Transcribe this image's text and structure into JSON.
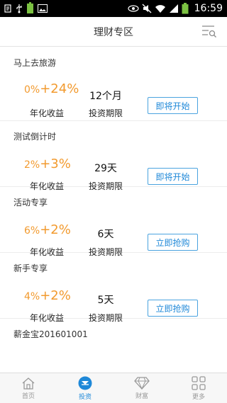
{
  "status_bar": {
    "time": "16:59",
    "icons": [
      "notification-icon",
      "usb-icon",
      "battery-small-icon",
      "image-icon",
      "eye-icon",
      "muted-icon",
      "wifi-icon",
      "signal-icon",
      "battery-icon"
    ]
  },
  "header": {
    "title": "理财专区",
    "menu_icon": "list-search-icon"
  },
  "products": [
    {
      "name": "马上去旅游",
      "rate_base": "0%",
      "rate_bonus": "+24%",
      "rate_label": "年化收益",
      "period": "12个月",
      "period_label": "投资期限",
      "button": "即将开始"
    },
    {
      "name": "测试倒计时",
      "rate_base": "2%",
      "rate_bonus": "+3%",
      "rate_label": "年化收益",
      "period": "29天",
      "period_label": "投资期限",
      "button": "即将开始"
    },
    {
      "name": "活动专享",
      "rate_base": "6%",
      "rate_bonus": "+2%",
      "rate_label": "年化收益",
      "period": "6天",
      "period_label": "投资期限",
      "button": "立即抢购"
    },
    {
      "name": "新手专享",
      "rate_base": "4%",
      "rate_bonus": "+2%",
      "rate_label": "年化收益",
      "period": "5天",
      "period_label": "投资期限",
      "button": "立即抢购"
    },
    {
      "name": "薪金宝201601001"
    }
  ],
  "tabs": [
    {
      "label": "首页",
      "icon": "home-icon",
      "active": false
    },
    {
      "label": "投资",
      "icon": "invest-icon",
      "active": true
    },
    {
      "label": "财富",
      "icon": "diamond-icon",
      "active": false
    },
    {
      "label": "更多",
      "icon": "grid-icon",
      "active": false
    }
  ],
  "colors": {
    "accent": "#1e88d8",
    "rate": "#f29a2e",
    "battery": "#7cc242"
  }
}
